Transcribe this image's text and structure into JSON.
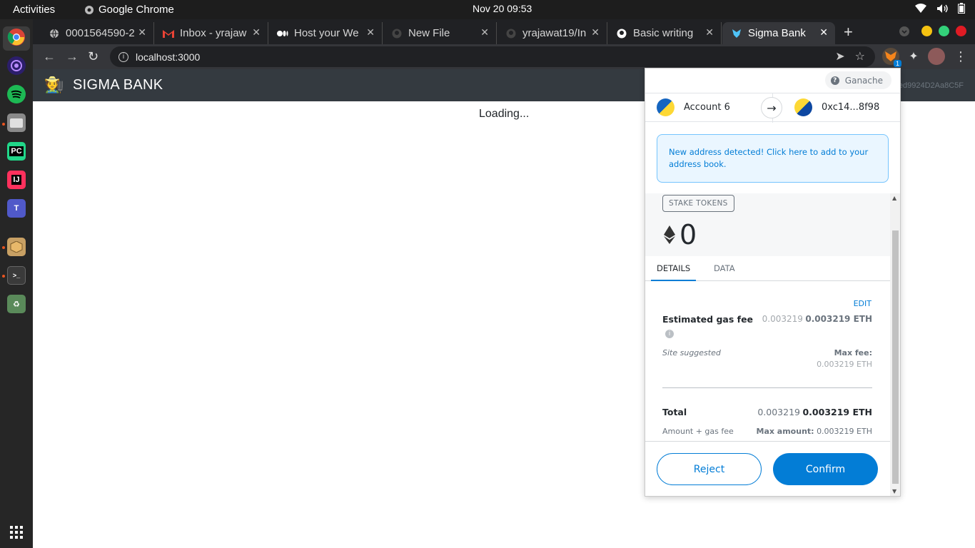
{
  "topbar": {
    "activities": "Activities",
    "app": "Google Chrome",
    "clock": "Nov 20  09:53"
  },
  "tabs": [
    {
      "title": "0001564590-2",
      "icon": "globe-icon"
    },
    {
      "title": "Inbox - yrajaw",
      "icon": "gmail-icon"
    },
    {
      "title": "Host your We",
      "icon": "medium-icon"
    },
    {
      "title": "New File",
      "icon": "github-icon"
    },
    {
      "title": "yrajawat19/In",
      "icon": "github-icon"
    },
    {
      "title": "Basic writing",
      "icon": "github-icon"
    },
    {
      "title": "Sigma Bank",
      "icon": "metamask-icon"
    }
  ],
  "omnibox": {
    "url": "localhost:3000"
  },
  "extensions": {
    "badge": "1"
  },
  "page": {
    "brand": "SIGMA BANK",
    "account_fragment": "0ed9924D2Aa8C5F",
    "loading": "Loading..."
  },
  "metamask": {
    "network": "Ganache",
    "from_account": "Account 6",
    "to_account": "0xc14...8f98",
    "alert": "New address detected! Click here to add to your address book.",
    "method": "STAKE TOKENS",
    "amount": "0",
    "tabs": {
      "details": "DETAILS",
      "data": "DATA"
    },
    "edit": "EDIT",
    "gas": {
      "label": "Estimated gas fee",
      "secondary": "0.003219",
      "primary": "0.003219 ETH",
      "site_suggested": "Site suggested",
      "max_fee_label": "Max fee:",
      "max_fee_value": "0.003219 ETH"
    },
    "total": {
      "label": "Total",
      "secondary": "0.003219",
      "primary": "0.003219 ETH",
      "sub_label": "Amount + gas fee",
      "max_amount_label": "Max amount:",
      "max_amount_value": "0.003219 ETH"
    },
    "buttons": {
      "reject": "Reject",
      "confirm": "Confirm"
    }
  },
  "colors": {
    "metamask_blue": "#037dd6",
    "navbar": "#343a40",
    "chrome_dark": "#202124"
  }
}
